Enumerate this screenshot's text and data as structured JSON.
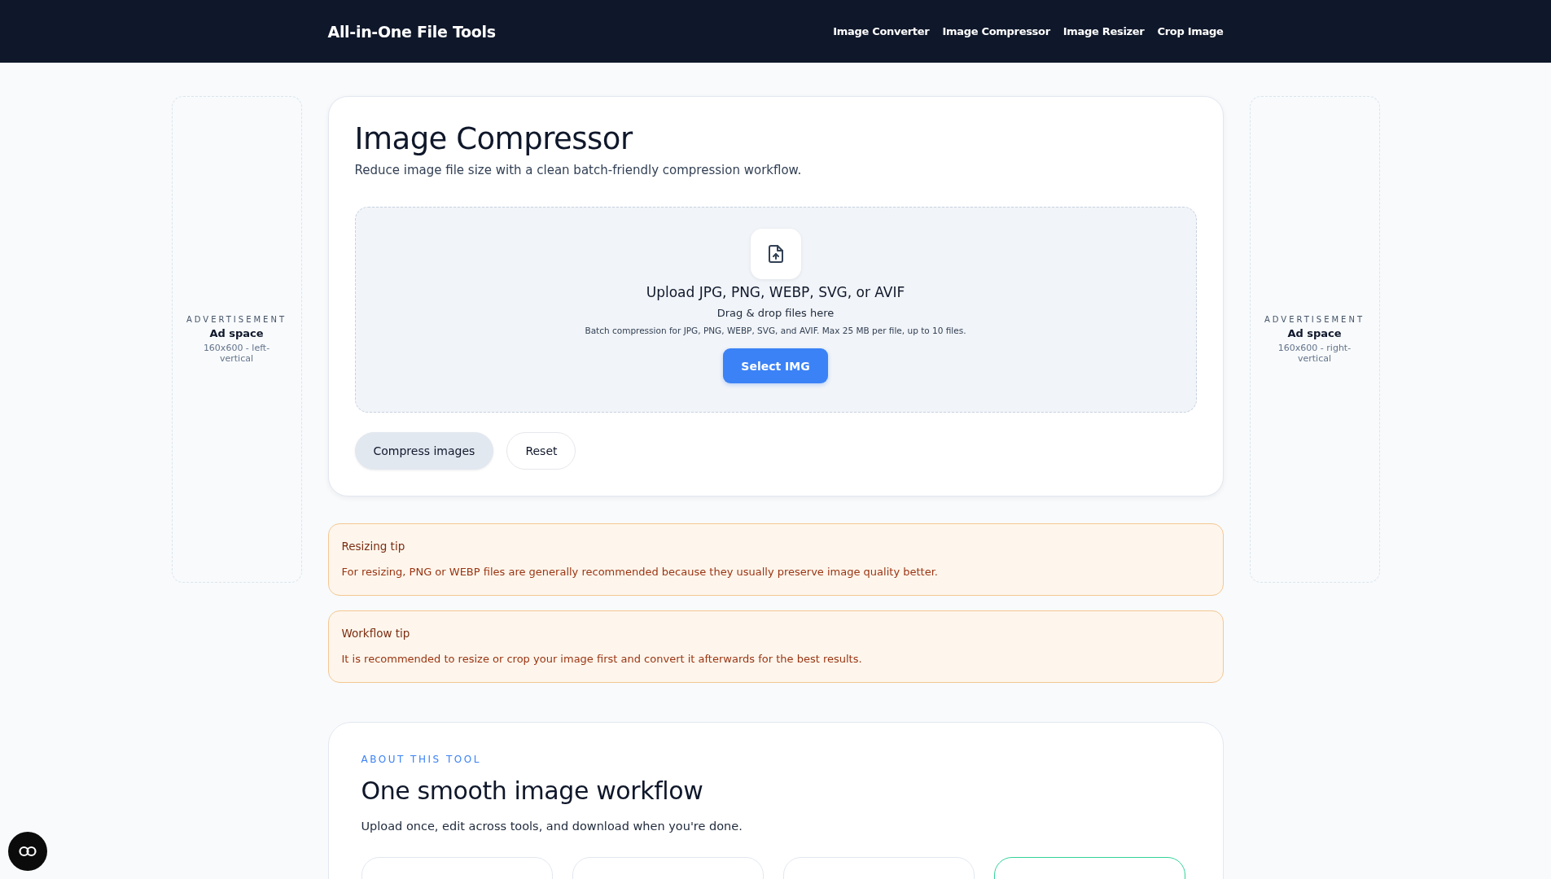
{
  "header": {
    "brand": "All-in-One File Tools",
    "nav": [
      "Image Converter",
      "Image Compressor",
      "Image Resizer",
      "Crop Image"
    ]
  },
  "left_ad": {
    "label": "ADVERTISEMENT",
    "title": "Ad space",
    "size": "160x600 - left-vertical"
  },
  "right_ad": {
    "label": "ADVERTISEMENT",
    "title": "Ad space",
    "size": "160x600 - right-vertical"
  },
  "tool": {
    "title": "Image Compressor",
    "subtitle": "Reduce image file size with a clean batch-friendly compression workflow.",
    "dropzone": {
      "heading": "Upload JPG, PNG, WEBP, SVG, or AVIF",
      "hint": "Drag & drop files here",
      "details": "Batch compression for JPG, PNG, WEBP, SVG, and AVIF. Max 25 MB per file, up to 10 files.",
      "button": "Select IMG"
    },
    "actions": [
      {
        "label": "Compress images",
        "kind": "secondary"
      },
      {
        "label": "Reset",
        "kind": "outline"
      }
    ]
  },
  "tips": [
    {
      "title": "Resizing tip",
      "text": "For resizing, PNG or WEBP files are generally recommended because they usually preserve image quality better."
    },
    {
      "title": "Workflow tip",
      "text": "It is recommended to resize or crop your image first and convert it afterwards for the best results."
    }
  ],
  "about": {
    "eyebrow": "ABOUT THIS TOOL",
    "title": "One smooth image workflow",
    "text": "Upload once, edit across tools, and download when you're done.",
    "cards": [
      {
        "selected": false
      },
      {
        "selected": false
      },
      {
        "selected": false
      },
      {
        "selected": true
      }
    ]
  }
}
